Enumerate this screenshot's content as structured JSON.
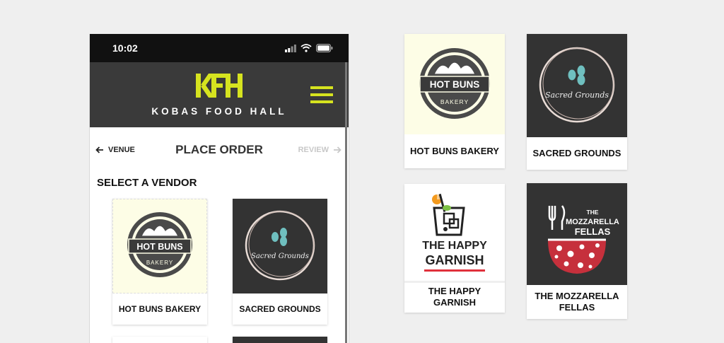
{
  "status_bar": {
    "time": "10:02"
  },
  "header": {
    "logo": "KFH",
    "hall_name": "KOBAS FOOD HALL"
  },
  "order_nav": {
    "back_label": "VENUE",
    "title": "PLACE ORDER",
    "next_label": "REVIEW"
  },
  "section_title": "SELECT A VENDOR",
  "vendors": [
    {
      "name": "HOT BUNS BAKERY",
      "logo_text": "HOT BUNS",
      "logo_sub": "BAKERY"
    },
    {
      "name": "SACRED GROUNDS",
      "logo_text": "Sacred Grounds"
    },
    {
      "name": "THE HAPPY GARNISH",
      "logo_text_1": "THE HAPPY",
      "logo_text_2": "GARNISH"
    },
    {
      "name": "THE MOZZARELLA FELLAS",
      "logo_text_1": "THE",
      "logo_text_2": "MOZZARELLA",
      "logo_text_3": "FELLAS"
    }
  ],
  "colors": {
    "accent": "#d6e31f",
    "header_bg": "#3a3a3a",
    "status_bg": "#111111",
    "card_cream": "#fdfde6",
    "card_dark": "#333333"
  },
  "icons": [
    "signal-icon",
    "wifi-icon",
    "battery-icon",
    "menu-icon",
    "arrow-left-icon",
    "arrow-right-icon"
  ]
}
